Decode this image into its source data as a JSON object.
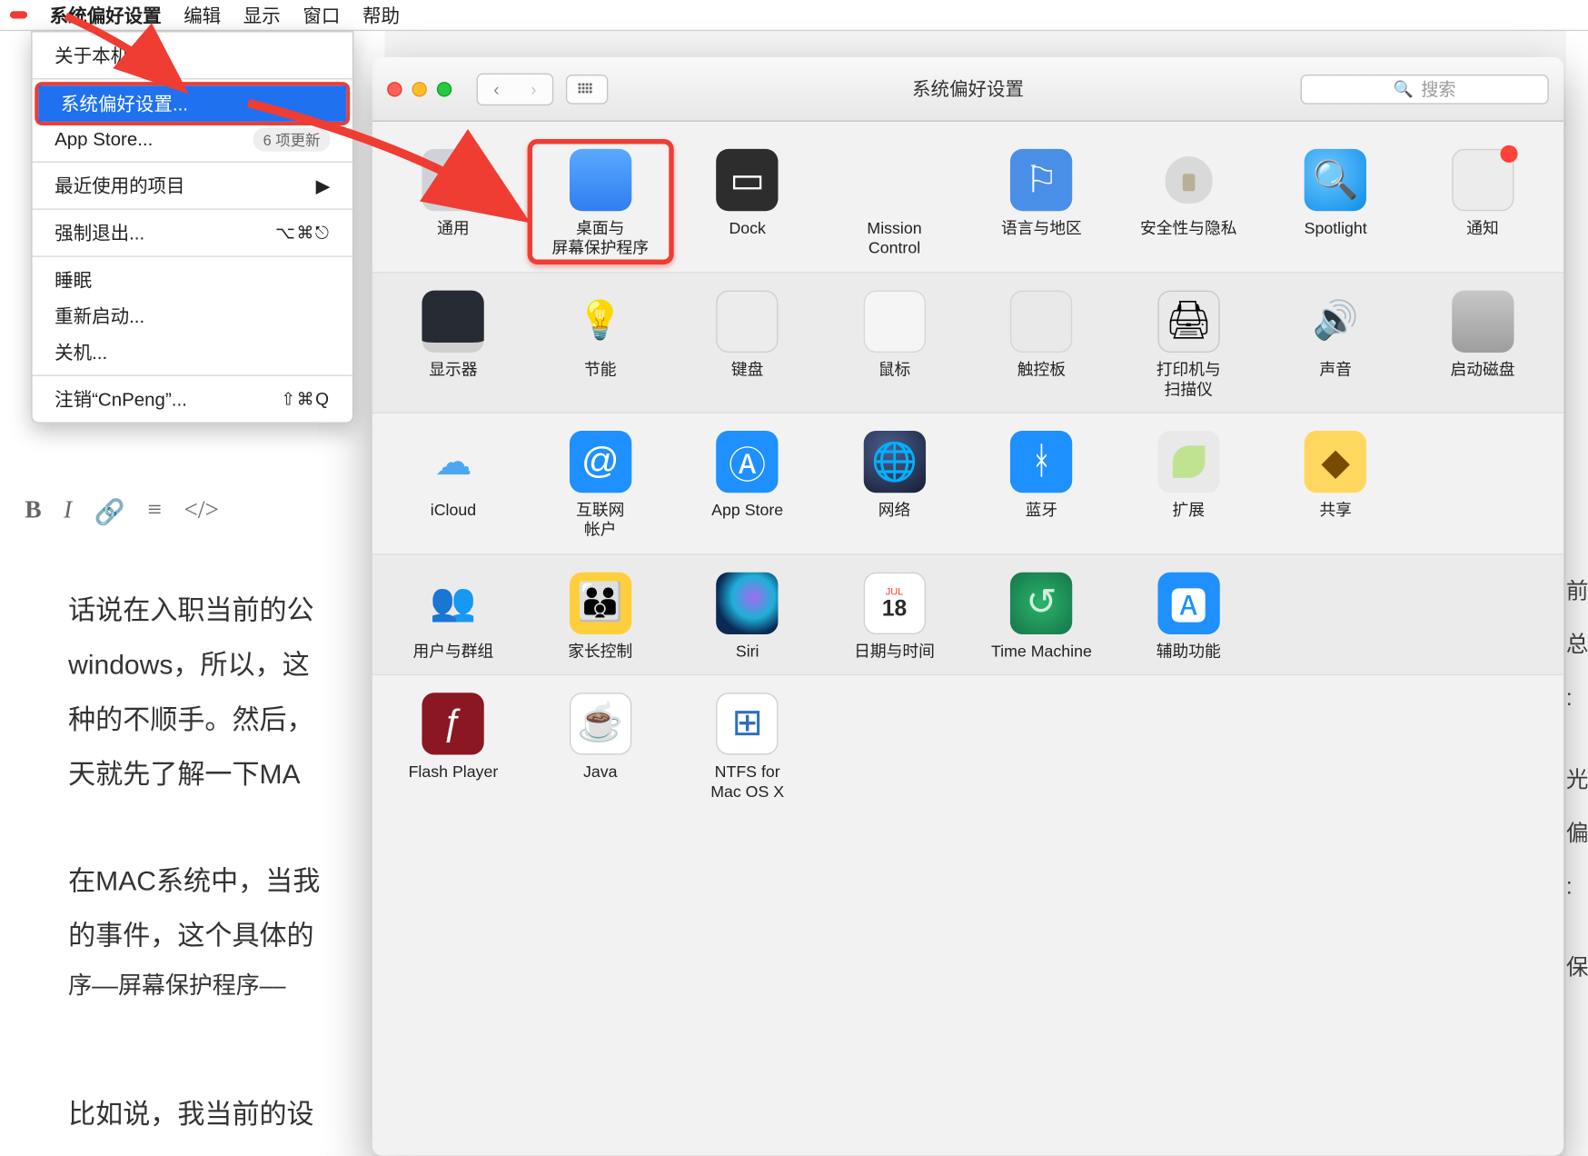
{
  "menubar": {
    "items": [
      "系统偏好设置",
      "编辑",
      "显示",
      "窗口",
      "帮助"
    ]
  },
  "apple_menu": {
    "about": "关于本机",
    "sysprefs": "系统偏好设置...",
    "appstore": "App Store...",
    "appstore_badge": "6 项更新",
    "recent": "最近使用的项目",
    "force_quit": "强制退出...",
    "force_quit_sc": "⌥⌘⎋",
    "sleep": "睡眠",
    "restart": "重新启动...",
    "shutdown": "关机...",
    "logout": "注销“CnPeng”...",
    "logout_sc": "⇧⌘Q"
  },
  "bg": {
    "toolbar": [
      "B",
      "I",
      "🔗",
      "≡",
      "</>"
    ],
    "p1a": "话说在入职当前的公",
    "p1b": "windows，所以，这",
    "p1c": "种的不顺手。然后，",
    "p1d": "天就先了解一下MA",
    "p2a": "在MAC系统中，当我",
    "p2b": "的事件，这个具体的",
    "p2c": "序––屏幕保护程序––",
    "p3a": "比如说，我当前的设"
  },
  "right_strip": [
    "前",
    "总",
    ":",
    "光",
    "偏",
    ":",
    "保"
  ],
  "sp": {
    "title": "系统偏好设置",
    "search_placeholder": "搜索",
    "row1": [
      {
        "label": "通用",
        "key": "general"
      },
      {
        "label": "桌面与\n屏幕保护程序",
        "key": "desktop"
      },
      {
        "label": "Dock",
        "key": "dock"
      },
      {
        "label": "Mission\nControl",
        "key": "mc"
      },
      {
        "label": "语言与地区",
        "key": "lang"
      },
      {
        "label": "安全性与隐私",
        "key": "sec"
      },
      {
        "label": "Spotlight",
        "key": "spot"
      },
      {
        "label": "通知",
        "key": "notif"
      }
    ],
    "row2": [
      {
        "label": "显示器",
        "key": "display"
      },
      {
        "label": "节能",
        "key": "energy"
      },
      {
        "label": "键盘",
        "key": "kb"
      },
      {
        "label": "鼠标",
        "key": "mouse"
      },
      {
        "label": "触控板",
        "key": "track"
      },
      {
        "label": "打印机与\n扫描仪",
        "key": "print"
      },
      {
        "label": "声音",
        "key": "sound"
      },
      {
        "label": "启动磁盘",
        "key": "start"
      }
    ],
    "row3": [
      {
        "label": "iCloud",
        "key": "icloud"
      },
      {
        "label": "互联网\n帐户",
        "key": "iacct"
      },
      {
        "label": "App Store",
        "key": "apps"
      },
      {
        "label": "网络",
        "key": "nw"
      },
      {
        "label": "蓝牙",
        "key": "bt"
      },
      {
        "label": "扩展",
        "key": "ext"
      },
      {
        "label": "共享",
        "key": "share"
      }
    ],
    "row4": [
      {
        "label": "用户与群组",
        "key": "users"
      },
      {
        "label": "家长控制",
        "key": "parent"
      },
      {
        "label": "Siri",
        "key": "siri"
      },
      {
        "label": "日期与时间",
        "key": "date"
      },
      {
        "label": "Time Machine",
        "key": "tm"
      },
      {
        "label": "辅助功能",
        "key": "acc"
      }
    ],
    "row5": [
      {
        "label": "Flash Player",
        "key": "flash"
      },
      {
        "label": "Java",
        "key": "java"
      },
      {
        "label": "NTFS for\nMac OS X",
        "key": "ntfs"
      }
    ],
    "date_icon": {
      "num": "18",
      "top": "JUL"
    }
  }
}
